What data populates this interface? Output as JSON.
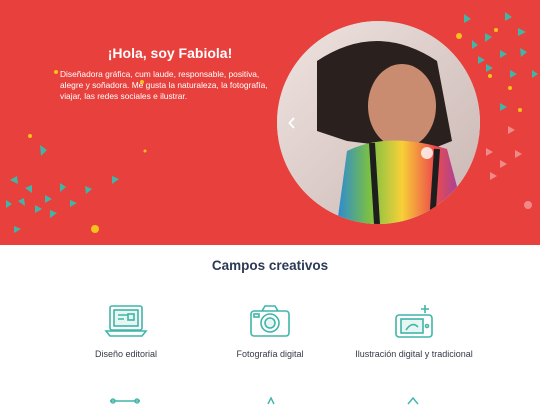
{
  "hero": {
    "title": "¡Hola, soy Fabiola!",
    "description": "Diseñadora gráfica, cum laude, responsable, positiva, alegre y soñadora. Me gusta la naturaleza, la fotografía, viajar, las redes sociales e ilustrar.",
    "prev_icon": "chevron-left-icon",
    "colors": {
      "background": "#e8413d",
      "confetti_teal": "#3fb6a8",
      "confetti_yellow": "#f5c21b"
    }
  },
  "creative_fields": {
    "title": "Campos creativos",
    "items": [
      {
        "label": "Diseño editorial",
        "icon": "laptop-icon"
      },
      {
        "label": "Fotografía digital",
        "icon": "camera-icon"
      },
      {
        "label": "Ilustración digital y tradicional",
        "icon": "drawing-tablet-icon"
      }
    ],
    "icon_color": "#3fb6a8"
  }
}
